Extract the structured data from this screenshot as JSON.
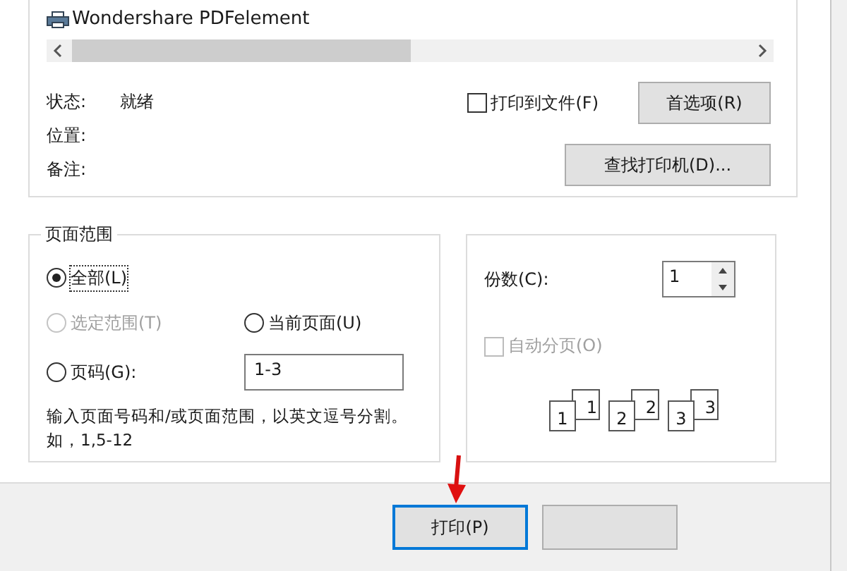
{
  "printer_list": {
    "items": [
      "Wondershare PDFelement"
    ]
  },
  "printer_info": [
    {
      "label": "状态:",
      "value": "就绪"
    },
    {
      "label": "位置:"
    },
    {
      "label": "备注:"
    }
  ],
  "print_to_file": {
    "label": "打印到文件(F)",
    "checked": false
  },
  "preferences_button": "首选项(R)",
  "find_printer_button": "查找打印机(D)...",
  "page_range": {
    "title": "页面范围",
    "options": [
      {
        "label": "全部(L)",
        "selected": true,
        "disabled": false
      },
      {
        "label": "选定范围(T)",
        "selected": false,
        "disabled": true
      },
      {
        "label": "当前页面(U)",
        "selected": false,
        "disabled": false
      },
      {
        "label": "页码(G):",
        "selected": false,
        "disabled": false
      }
    ],
    "pages_field": "1-3",
    "hint": "输入页面号码和/或页面范围，以英文逗号分割。如，1,5-12"
  },
  "copies": {
    "label": "份数(C):",
    "value": "1",
    "collate": {
      "label": "自动分页(O)",
      "checked": false,
      "disabled": true
    },
    "collate_pages": [
      "1",
      "1",
      "2",
      "2",
      "3",
      "3"
    ]
  },
  "print_button": {
    "label": "打印(P)",
    "focused": true
  }
}
